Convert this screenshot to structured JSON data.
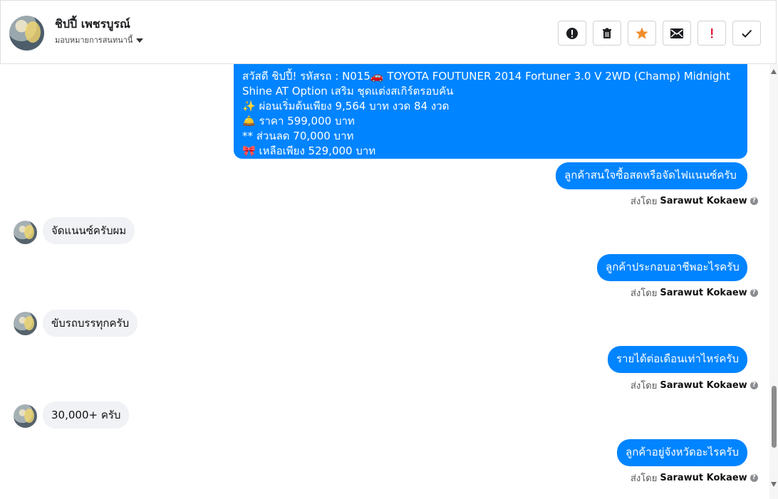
{
  "header": {
    "contact_name": "ชิปปี้ เพชรบูรณ์",
    "assign_label": "มอบหมายการสนทนานี้",
    "actions": [
      {
        "icon": "alert-circle-icon",
        "label": "!"
      },
      {
        "icon": "trash-icon",
        "label": "delete"
      },
      {
        "icon": "star-icon",
        "label": "star"
      },
      {
        "icon": "mail-icon",
        "label": "mail"
      },
      {
        "icon": "exclamation-icon",
        "label": "!"
      },
      {
        "icon": "check-icon",
        "label": "check"
      }
    ]
  },
  "messages": {
    "long_bubble": [
      "สวัสดี ชิปปี้!  รหัสรถ : N015🚗 TOYOTA FOUTUNER 2014 Fortuner 3.0 V 2WD (Champ) Midnight",
      "Shine AT  Option เสริม ชุดแต่งสเกิร์ตรอบคัน",
      "✨ ผ่อนเริ่มต้นเพียง 9,564 บาท งวด 84 งวด",
      "🛎️ ราคา 599,000 บาท",
      "** ส่วนลด 70,000 บาท",
      "🎀 เหลือเพียง 529,000 บาท"
    ],
    "outgoing_1": "ลูกค้าสนใจซื้อสดหรือจัดไฟแนนซ์ครับ",
    "incoming_1": "จัดแนนซ์ครับผม",
    "outgoing_2": "ลูกค้าประกอบอาชีพอะไรครับ",
    "incoming_2": "ขับรถบรรทุกครับ",
    "outgoing_3": "รายได้ต่อเดือนเท่าไหร่ครับ",
    "incoming_3": "30,000+ ครับ",
    "outgoing_4": "ลูกค้าอยู่จังหวัดอะไรครับ",
    "sent_by_prefix": "ส่งโดย",
    "sender_name": "Sarawut Kokaew"
  },
  "colors": {
    "outgoing_bubble": "#0084ff",
    "incoming_bubble": "#f0f2f5",
    "star": "#f08d2d",
    "warning": "#e41e3f"
  }
}
